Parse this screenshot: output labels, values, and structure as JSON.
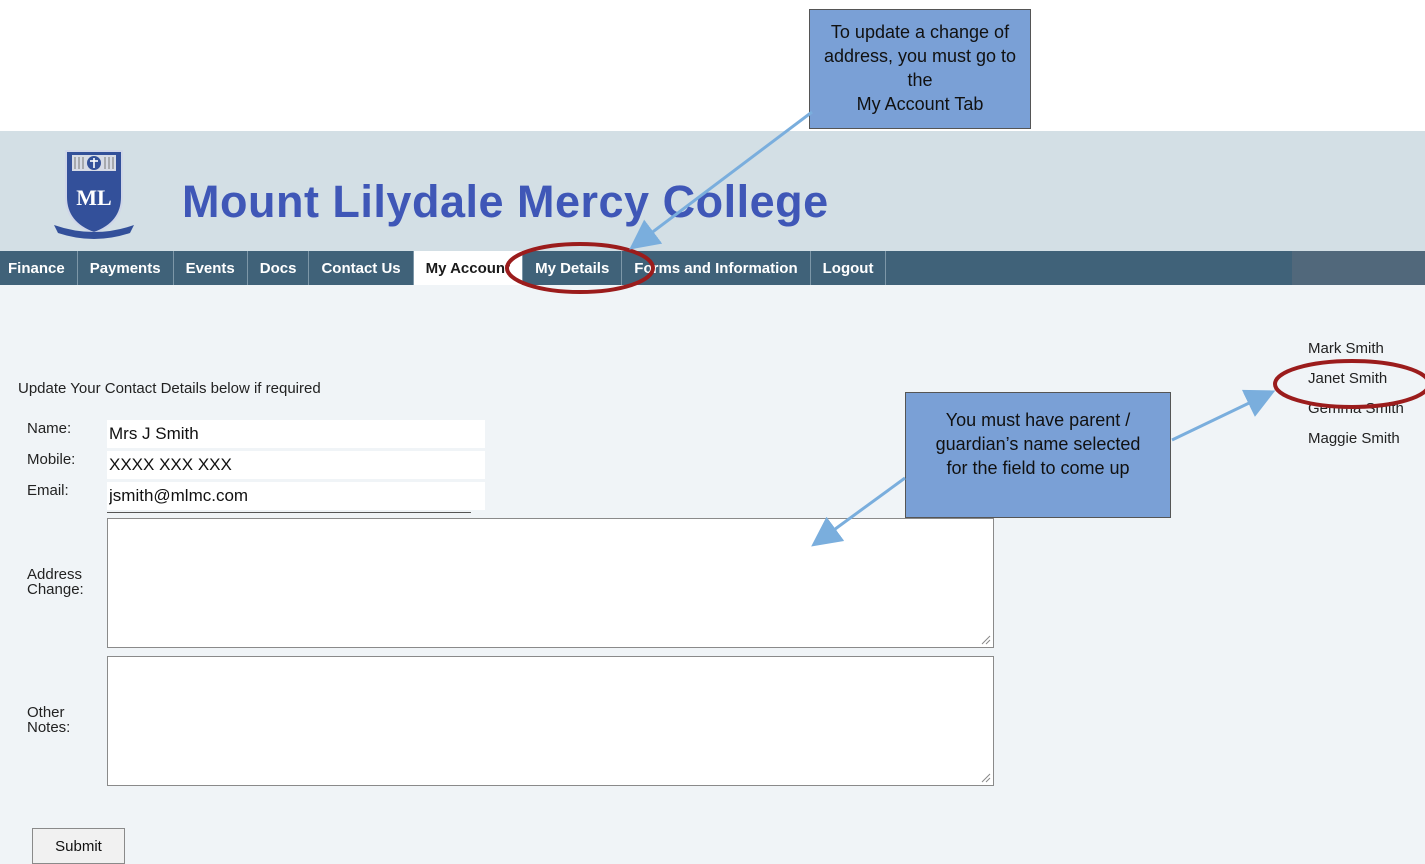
{
  "header": {
    "college_name": "Mount Lilydale Mercy College"
  },
  "nav": {
    "items": [
      {
        "label": "Finance"
      },
      {
        "label": "Payments"
      },
      {
        "label": "Events"
      },
      {
        "label": "Docs"
      },
      {
        "label": "Contact Us"
      },
      {
        "label": "My Account"
      },
      {
        "label": "My Details"
      },
      {
        "label": "Forms and Information"
      },
      {
        "label": "Logout"
      }
    ],
    "active": "My Account"
  },
  "form": {
    "intro": "Update Your Contact Details below if required",
    "name_label": "Name:",
    "name_value": "Mrs J Smith",
    "mobile_label": "Mobile:",
    "mobile_value": "XXXX XXX XXX",
    "email_label": "Email:",
    "email_value": "jsmith@mlmc.com",
    "address_label_line1": "Address",
    "address_label_line2": "Change:",
    "notes_label_line1": "Other",
    "notes_label_line2": "Notes:",
    "submit_label": "Submit"
  },
  "students": [
    {
      "name": "Mark Smith"
    },
    {
      "name": "Janet Smith"
    },
    {
      "name": "Gemma Smith"
    },
    {
      "name": "Maggie Smith"
    }
  ],
  "selected_student": "Janet Smith",
  "callouts": {
    "top_line1": "To update a change of",
    "top_line2": "address, you must go to the",
    "top_line3": "My Account Tab",
    "mid_line1": "You must have parent /",
    "mid_line2": "guardian’s name selected",
    "mid_line3": "for the field to come up"
  },
  "colors": {
    "header_bg": "#d3dfe5",
    "nav_bg": "#406279",
    "title_blue": "#3f57b7",
    "content_bg": "#f0f4f7",
    "callout_bg": "#7aa0d6",
    "highlight_ring": "#9b1c1c",
    "arrow": "#7aaedd"
  },
  "icons": [
    "school-crest-icon",
    "resize-grip-icon"
  ]
}
